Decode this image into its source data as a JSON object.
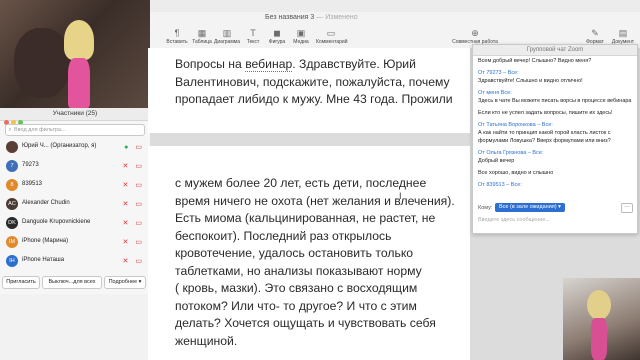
{
  "window": {
    "title": "Без названия 3",
    "subtitle": "— Изменено"
  },
  "toolbar": {
    "left_items": [
      {
        "label": "Вставить",
        "icon": "paragraph-icon",
        "glyph": "¶"
      },
      {
        "label": "Таблица",
        "icon": "table-icon",
        "glyph": "▦"
      },
      {
        "label": "Диаграмма",
        "icon": "chart-icon",
        "glyph": "▥"
      },
      {
        "label": "Текст",
        "icon": "text-icon",
        "glyph": "T"
      },
      {
        "label": "Фигура",
        "icon": "shape-icon",
        "glyph": "◼"
      },
      {
        "label": "Медиа",
        "icon": "media-icon",
        "glyph": "▣"
      },
      {
        "label": "Комментарий",
        "icon": "comment-icon",
        "glyph": "▭"
      }
    ],
    "collab_label": "Совместная работа",
    "right_items": [
      {
        "label": "Формат",
        "icon": "format-icon",
        "glyph": "✎"
      },
      {
        "label": "Документ",
        "icon": "document-icon",
        "glyph": "▤"
      }
    ]
  },
  "document": {
    "page1_lines": [
      "Вопросы на вебинар. Здравствуйте. Юрий",
      "Валентинович, подскажите, пожалуйста, почему",
      "пропадает либидо к мужу. Мне 43 года. Прожили"
    ],
    "page2_lines": [
      "с мужем более 20 лет, есть дети, последнее",
      "время ничего не охота (нет желания и влечения).",
      "Есть миома (кальцинированная, не растет, не",
      "беспокоит). Последний раз открылось",
      "кровотечение, удалось остановить только",
      "таблетками, но анализы показывают норму",
      "( кровь, мазки). Это связано с восходящим",
      "потоком? Или что- то другое? И что с этим",
      "делать? Хочется ощущать и чувствовать себя",
      "женщиной."
    ]
  },
  "participants": {
    "title": "Участники (25)",
    "filter_placeholder": "Ввод для фильтра...",
    "list": [
      {
        "initials": "",
        "name": "Юрий Ч...  (Организатор, я)",
        "color": "#5a3f36",
        "mic": "on"
      },
      {
        "initials": "7",
        "name": "79273",
        "color": "#3e6fb8",
        "mic": "off"
      },
      {
        "initials": "8",
        "name": "839513",
        "color": "#e08a2c",
        "mic": "off"
      },
      {
        "initials": "AC",
        "name": "Alexander Chudin",
        "color": "#4a3a33",
        "mic": "off"
      },
      {
        "initials": "DK",
        "name": "Danguole Krupovnickiene",
        "color": "#2a2a2a",
        "mic": "off"
      },
      {
        "initials": "IM",
        "name": "iPhone (Марина)",
        "color": "#e08a2c",
        "mic": "off"
      },
      {
        "initials": "IH",
        "name": "iPhone Наташа",
        "color": "#2c6fd1",
        "mic": "off"
      }
    ],
    "buttons": {
      "invite": "Пригласить",
      "mute_all": "Выключ...для всех",
      "more": "Подробнее ▾"
    }
  },
  "chat": {
    "title": "Групповой чат Zoom",
    "messages": [
      {
        "from": "",
        "text": "Всем добрый вечер! Слышно? Видно меня?"
      },
      {
        "from": "От 79273 – Все:",
        "text": "Здравствуйте! Слышно и видно отлично!"
      },
      {
        "from": "От меня Все:",
        "text": "Здесь в чате Вы можете писать ворсы в процессе вебинара"
      },
      {
        "from": "",
        "text": "Если кто не успел задать вопросы, пишите их здесь!"
      },
      {
        "from": "От Татьяна Воронкова – Все:",
        "text": "А как найти то принцип какой торой класть листок с формулами Ловушка? Вверх формулами или вниз?"
      },
      {
        "from": "От Ольга Грязнова – Все:",
        "text": "Добрый вечер"
      },
      {
        "from": "",
        "text": "Все хорошо, видно и слышно"
      },
      {
        "from": "От 839513 – Все:",
        "text": ""
      }
    ],
    "to_label": "Кому:",
    "to_value": "Все (в зале ожидания) ▾",
    "more_label": "···",
    "input_placeholder": "Введите здесь сообщение..."
  }
}
